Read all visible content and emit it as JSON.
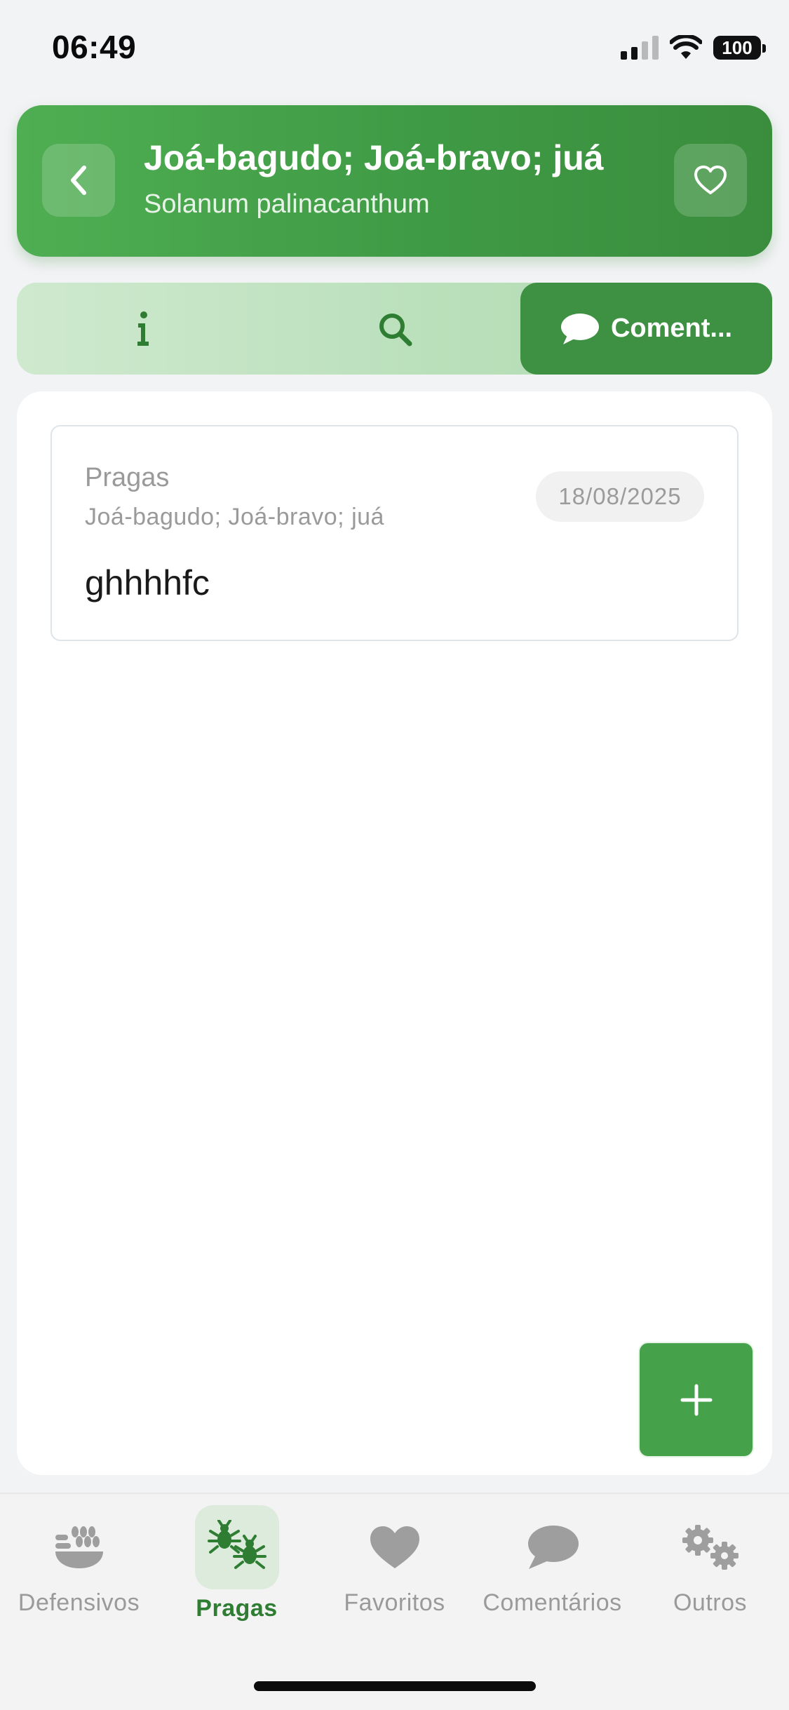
{
  "status_bar": {
    "time": "06:49",
    "battery": "100"
  },
  "header": {
    "title": "Joá-bagudo; Joá-bravo; juá",
    "subtitle": "Solanum palinacanthum",
    "back_icon": "chevron-left-icon",
    "favorite_icon": "heart-outline-icon"
  },
  "tabs": [
    {
      "icon": "info-icon",
      "label": ""
    },
    {
      "icon": "search-icon",
      "label": ""
    },
    {
      "icon": "comment-icon",
      "label": "Coment..."
    }
  ],
  "comments": [
    {
      "type": "Pragas",
      "name": "Joá-bagudo; Joá-bravo; juá",
      "date": "18/08/2025",
      "text": "ghhhhfc"
    }
  ],
  "fab": {
    "icon": "plus-icon"
  },
  "bottom_nav": [
    {
      "label": "Defensivos",
      "icon": "grain-bowl-icon",
      "active": false
    },
    {
      "label": "Pragas",
      "icon": "bugs-icon",
      "active": true
    },
    {
      "label": "Favoritos",
      "icon": "heart-icon",
      "active": false
    },
    {
      "label": "Comentários",
      "icon": "comment-icon",
      "active": false
    },
    {
      "label": "Outros",
      "icon": "gears-icon",
      "active": false
    }
  ],
  "colors": {
    "primary": "#43A047",
    "primary_dark": "#3E9142",
    "active_nav": "#2E7D32",
    "inactive_nav": "#9A9A9A"
  }
}
